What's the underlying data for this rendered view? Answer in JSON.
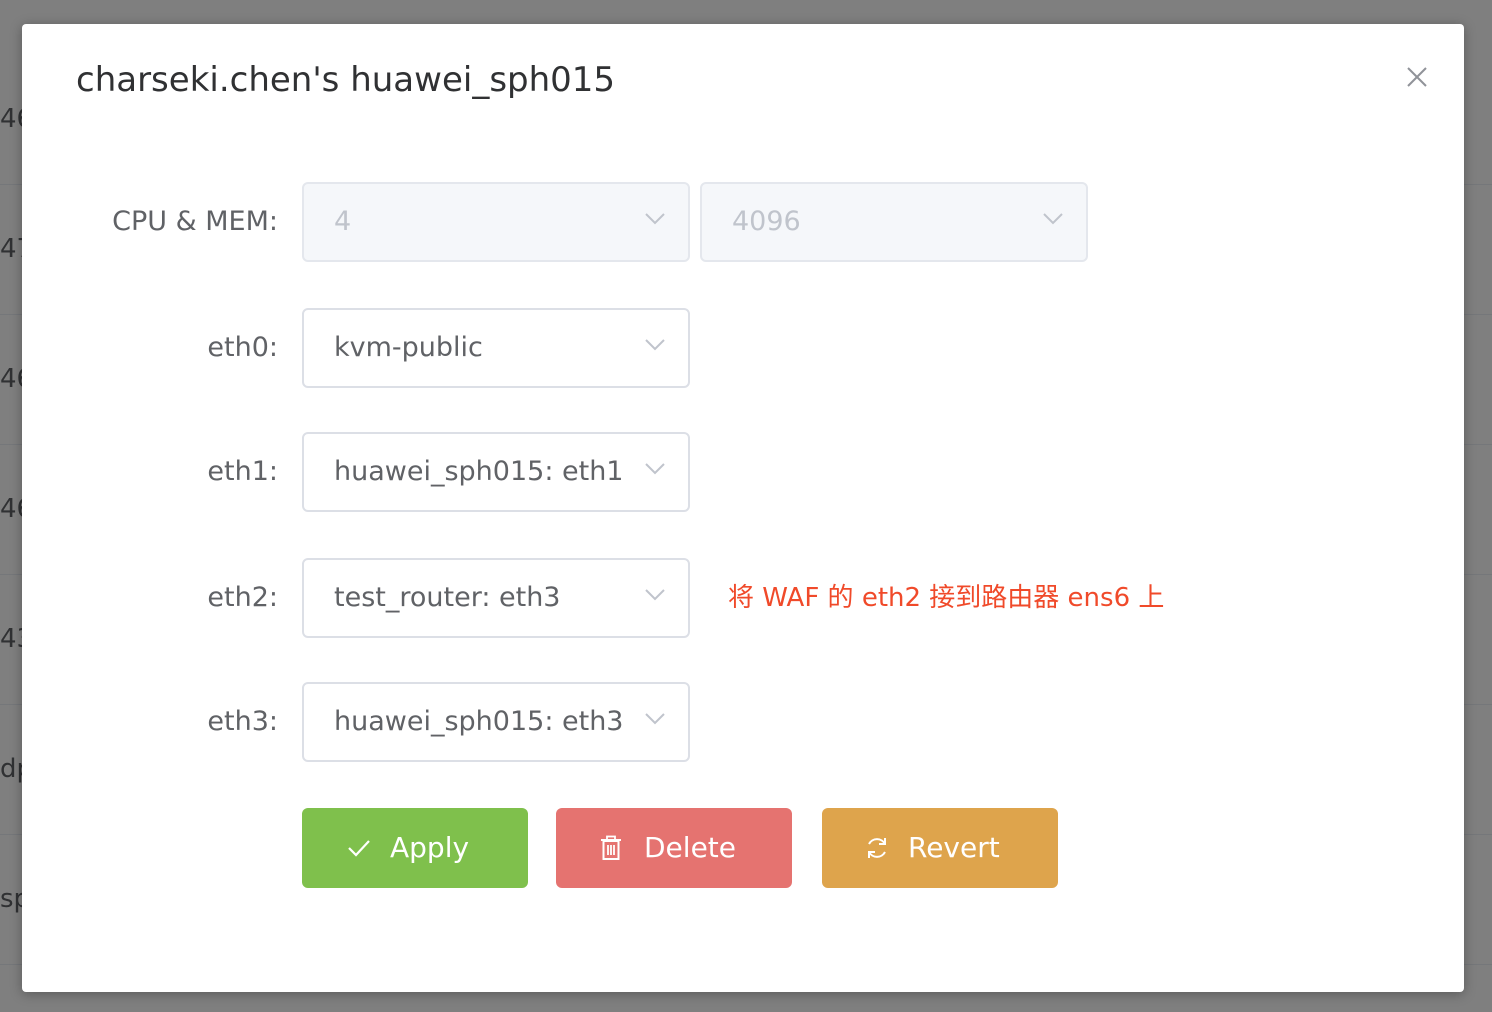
{
  "background": {
    "row_prefixes": [
      "46",
      "47",
      "46",
      "46",
      "43",
      "dp",
      "sp"
    ]
  },
  "dialog": {
    "title": "charseki.chen's huawei_sph015",
    "close_icon": "close-icon"
  },
  "form": {
    "cpu_mem": {
      "label": "CPU & MEM:",
      "cpu_value": "4",
      "mem_value": "4096",
      "disabled": true
    },
    "eth0": {
      "label": "eth0:",
      "value": "kvm-public"
    },
    "eth1": {
      "label": "eth1:",
      "value": "huawei_sph015: eth1"
    },
    "eth2": {
      "label": "eth2:",
      "value": "test_router: eth3",
      "note": "将 WAF 的 eth2 接到路由器 ens6 上"
    },
    "eth3": {
      "label": "eth3:",
      "value": "huawei_sph015: eth3"
    }
  },
  "buttons": {
    "apply": {
      "label": "Apply",
      "icon": "check-icon",
      "color": "#7fc04c"
    },
    "delete": {
      "label": "Delete",
      "icon": "trash-icon",
      "color": "#e57370"
    },
    "revert": {
      "label": "Revert",
      "icon": "refresh-icon",
      "color": "#dea44c"
    }
  },
  "colors": {
    "note": "#f04a2a",
    "overlay": "rgba(0,0,0,0.5)"
  }
}
